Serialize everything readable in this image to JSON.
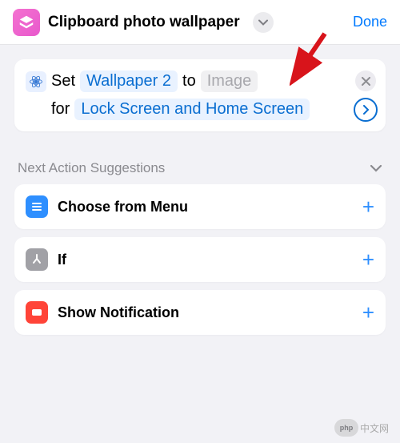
{
  "header": {
    "title": "Clipboard photo wallpaper",
    "done_label": "Done"
  },
  "action": {
    "set_label": "Set",
    "wallpaper_pill": "Wallpaper 2",
    "to_label": "to",
    "image_pill": "Image",
    "for_label": "for",
    "target_pill": "Lock Screen and Home Screen"
  },
  "suggestions": {
    "title": "Next Action Suggestions",
    "items": [
      {
        "label": "Choose from Menu"
      },
      {
        "label": "If"
      },
      {
        "label": "Show Notification"
      }
    ]
  },
  "watermark": {
    "logo": "php",
    "text": "中文网"
  }
}
